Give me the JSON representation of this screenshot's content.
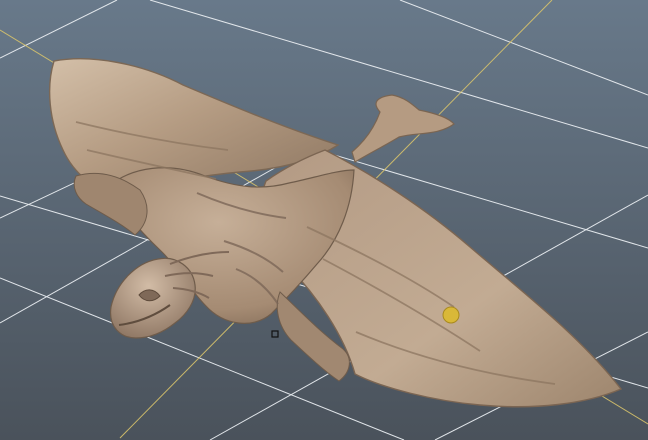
{
  "viewport": {
    "background_top": "#68798a",
    "background_bottom": "#4a525b",
    "grid_line_color": "#e9edf1",
    "axis_color": "#d8c36b",
    "model_base_color": "#a9907a",
    "model_highlight_color": "#d3bfa8",
    "model_shadow_color": "#6f5c4b",
    "manipulator_color": "#d9b838",
    "pivot_marker_color": "#111111",
    "model_icon": "creature-sculpt-icon",
    "pivot_icon": "pivot-square-icon",
    "manipulator_icon": "manipulator-dot-icon"
  }
}
